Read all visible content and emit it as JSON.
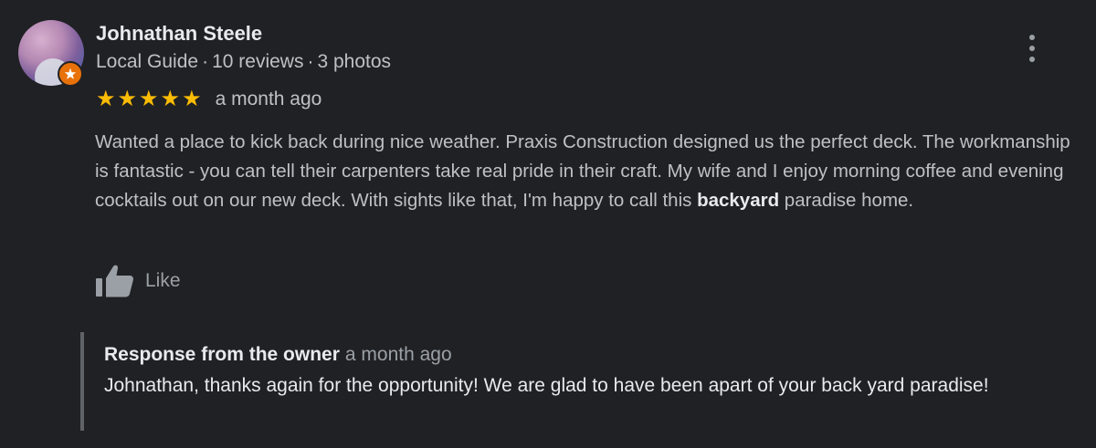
{
  "reviewer": {
    "name": "Johnathan Steele",
    "role": "Local Guide",
    "reviews": "10 reviews",
    "photos": "3 photos",
    "separator": "·"
  },
  "rating": {
    "stars": 5,
    "max": 5,
    "time": "a month ago"
  },
  "review": {
    "text_before": "Wanted a place to kick back during nice weather. Praxis Construction designed us the perfect deck. The workmanship is fantastic - you can tell their carpenters take real pride in their craft. My wife and I enjoy morning coffee and evening cocktails out on our new deck. With sights like that, I'm happy to call this ",
    "highlight": "backyard",
    "text_after": " paradise home."
  },
  "actions": {
    "like_label": "Like"
  },
  "owner_response": {
    "title": "Response from the owner",
    "time": "a month ago",
    "text": "Johnathan, thanks again for the opportunity! We are glad to have been apart of your back yard paradise!"
  },
  "icons": {
    "avatar": "avatar",
    "badge": "local-guide-badge-icon",
    "more": "more-vert-icon",
    "star": "star-icon",
    "like": "thumb-up-icon"
  },
  "colors": {
    "background": "#202124",
    "star": "#fbbc04",
    "badge": "#e8710a",
    "primary_text": "#e8eaed",
    "secondary_text": "#bdc1c6"
  }
}
